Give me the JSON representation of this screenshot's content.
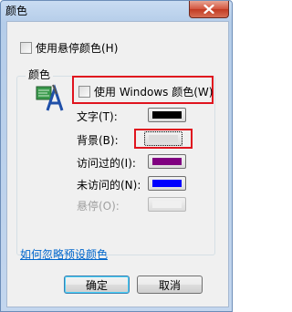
{
  "window": {
    "title": "颜色"
  },
  "hover_color_option": {
    "label": "使用悬停颜色(H)",
    "checked": false
  },
  "colors_group": {
    "legend": "颜色",
    "use_windows_colors": {
      "label": "使用 Windows 颜色(W)",
      "checked": false
    },
    "rows": [
      {
        "label": "文字(T):",
        "color": "#000000",
        "enabled": true
      },
      {
        "label": "背景(B):",
        "color": "#dcdcdc",
        "enabled": true
      },
      {
        "label": "访问过的(I):",
        "color": "#800080",
        "enabled": true
      },
      {
        "label": "未访问的(N):",
        "color": "#0000ff",
        "enabled": true
      },
      {
        "label": "悬停(O):",
        "color": "#f0f0f0",
        "enabled": false
      }
    ]
  },
  "link_text": "如何忽略预设颜色",
  "buttons": {
    "ok": "确定",
    "cancel": "取消"
  },
  "icons": {
    "close": "close-icon",
    "accessibility": "accessibility-text-icon"
  },
  "accent": {
    "highlight": "#e0141e",
    "link": "#0066cc"
  }
}
